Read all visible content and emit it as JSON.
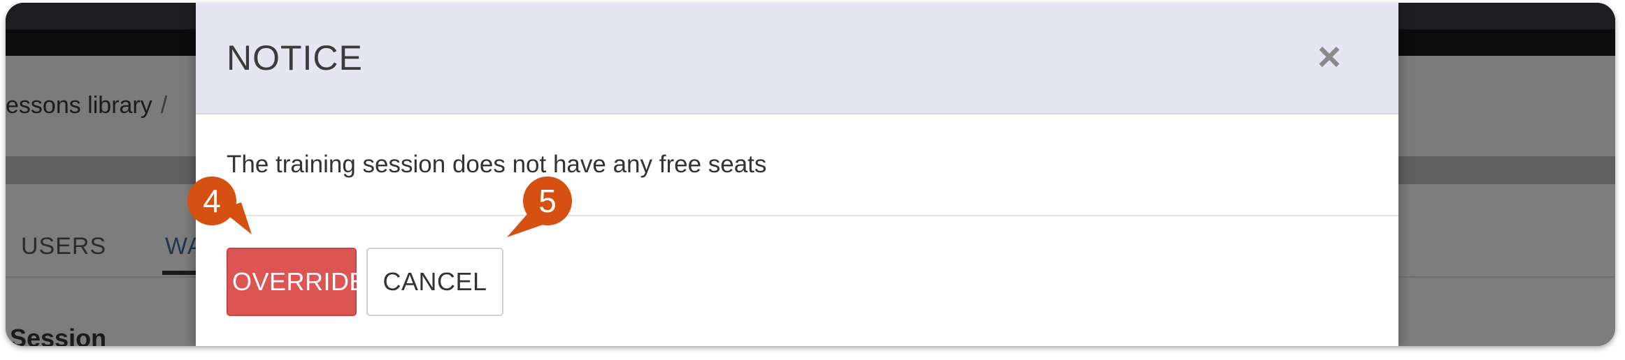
{
  "background_app": {
    "breadcrumb": {
      "text": "essons library",
      "separator": "/"
    },
    "tabs": [
      {
        "label": "USERS"
      },
      {
        "label": "WA"
      }
    ],
    "section_label": "Session"
  },
  "modal": {
    "title": "NOTICE",
    "close_symbol": "×",
    "message": "The training session does not have any free seats",
    "buttons": {
      "override_label": "OVERRIDE",
      "cancel_label": "CANCEL"
    }
  },
  "callouts": [
    {
      "number": "4"
    },
    {
      "number": "5"
    }
  ],
  "colors": {
    "override": "#dc5552",
    "callout": "#d65111",
    "header": "#e6e6f2"
  }
}
